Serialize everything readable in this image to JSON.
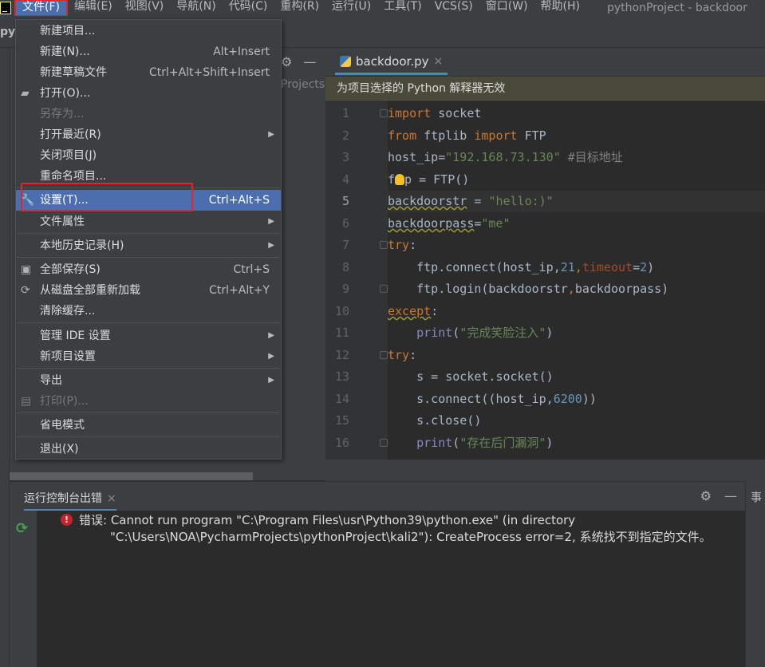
{
  "menubar": {
    "items": [
      "文件(F)",
      "编辑(E)",
      "视图(V)",
      "导航(N)",
      "代码(C)",
      "重构(R)",
      "运行(U)",
      "工具(T)",
      "VCS(S)",
      "窗口(W)",
      "帮助(H)"
    ],
    "window_title": "pythonProject - backdoor"
  },
  "navbar": {
    "project_partial": "py"
  },
  "project_panel": {
    "partial_text": "Projects"
  },
  "editor": {
    "tab_label": "backdoor.py",
    "tab_close": "×",
    "warning": "为项目选择的 Python 解释器无效",
    "current_line": 5,
    "line_numbers": [
      "1",
      "2",
      "3",
      "4",
      "5",
      "6",
      "7",
      "8",
      "9",
      "10",
      "11",
      "12",
      "13",
      "14",
      "15",
      "16"
    ]
  },
  "file_menu": {
    "items": [
      {
        "label": "新建项目...",
        "shortcut": ""
      },
      {
        "label": "新建(N)...",
        "shortcut": "Alt+Insert"
      },
      {
        "label": "新建草稿文件",
        "shortcut": "Ctrl+Alt+Shift+Insert"
      },
      {
        "label": "打开(O)...",
        "shortcut": "",
        "icon": "folder-icon"
      },
      {
        "label": "另存为...",
        "shortcut": "",
        "disabled": true
      },
      {
        "label": "打开最近(R)",
        "shortcut": "",
        "submenu": true
      },
      {
        "label": "关闭项目(J)",
        "shortcut": ""
      },
      {
        "label": "重命名项目...",
        "shortcut": ""
      },
      {
        "label": "设置(T)...",
        "shortcut": "Ctrl+Alt+S",
        "icon": "wrench-icon",
        "selected": true
      },
      {
        "label": "文件属性",
        "shortcut": "",
        "submenu": true
      },
      {
        "label": "本地历史记录(H)",
        "shortcut": "",
        "submenu": true
      },
      {
        "label": "全部保存(S)",
        "shortcut": "Ctrl+S",
        "icon": "save-icon"
      },
      {
        "label": "从磁盘全部重新加载",
        "shortcut": "Ctrl+Alt+Y",
        "icon": "reload-icon"
      },
      {
        "label": "清除缓存...",
        "shortcut": ""
      },
      {
        "label": "管理 IDE 设置",
        "shortcut": "",
        "submenu": true
      },
      {
        "label": "新项目设置",
        "shortcut": "",
        "submenu": true
      },
      {
        "label": "导出",
        "shortcut": "",
        "submenu": true
      },
      {
        "label": "打印(P)...",
        "shortcut": "",
        "disabled": true,
        "icon": "print-icon"
      },
      {
        "label": "省电模式",
        "shortcut": ""
      },
      {
        "label": "退出(X)",
        "shortcut": ""
      }
    ]
  },
  "run_panel": {
    "tab_label": "运行控制台出错",
    "tab_close": "×",
    "error_line1": "错误: Cannot run program \"C:\\Program Files\\usr\\Python39\\python.exe\" (in directory",
    "error_line2": "\"C:\\Users\\NOA\\PycharmProjects\\pythonProject\\kali2\"): CreateProcess error=2, 系统找不到指定的文件。",
    "right_label": "事"
  }
}
